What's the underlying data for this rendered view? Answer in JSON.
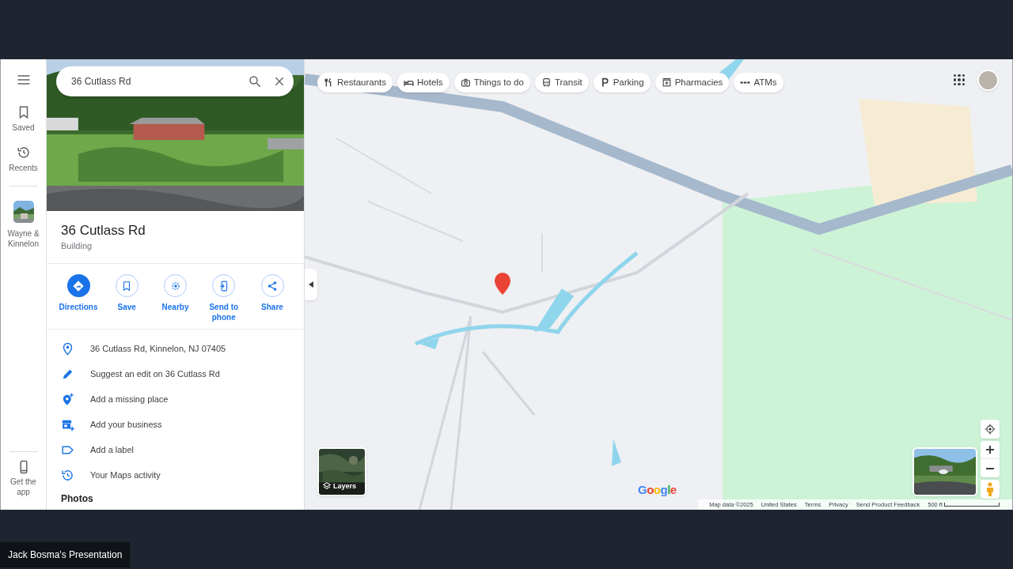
{
  "rail": {
    "items": [
      {
        "kind": "menu"
      },
      {
        "kind": "bookmark",
        "label": "Saved"
      },
      {
        "kind": "history",
        "label": "Recents"
      },
      {
        "kind": "thumbnail",
        "label": "Wayne & Kinnelon"
      }
    ],
    "footer_item": {
      "kind": "phone",
      "label": "Get the app"
    }
  },
  "search": {
    "value": "36 Cutlass Rd"
  },
  "place": {
    "title": "36 Cutlass Rd",
    "category": "Building"
  },
  "actions": [
    {
      "kind": "directions",
      "label": "Directions",
      "primary": true
    },
    {
      "kind": "bookmark",
      "label": "Save",
      "primary": false
    },
    {
      "kind": "nearby",
      "label": "Nearby",
      "primary": false
    },
    {
      "kind": "send",
      "label": "Send to phone",
      "primary": false
    },
    {
      "kind": "share",
      "label": "Share",
      "primary": false
    }
  ],
  "details": [
    {
      "kind": "pin",
      "text": "36 Cutlass Rd, Kinnelon, NJ 07405"
    },
    {
      "kind": "pencil",
      "text": "Suggest an edit on 36 Cutlass Rd"
    },
    {
      "kind": "pinplus",
      "text": "Add a missing place"
    },
    {
      "kind": "store",
      "text": "Add your business"
    },
    {
      "kind": "label",
      "text": "Add a label"
    },
    {
      "kind": "history",
      "text": "Your Maps activity"
    }
  ],
  "photos_heading": "Photos",
  "chips": [
    {
      "kind": "fork",
      "label": "Restaurants"
    },
    {
      "kind": "bed",
      "label": "Hotels"
    },
    {
      "kind": "camera",
      "label": "Things to do"
    },
    {
      "kind": "bus",
      "label": "Transit"
    },
    {
      "kind": "parking",
      "label": "Parking"
    },
    {
      "kind": "pharmacy",
      "label": "Pharmacies"
    },
    {
      "kind": "atm",
      "label": "ATMs"
    }
  ],
  "layers": {
    "label": "Layers"
  },
  "google_logo": "Google",
  "footer": {
    "links": [
      "Map data ©2025",
      "United States",
      "Terms",
      "Privacy",
      "Send Product Feedback"
    ],
    "scale": "500 ft"
  },
  "presenter": "Jack Bosma's Presentation"
}
